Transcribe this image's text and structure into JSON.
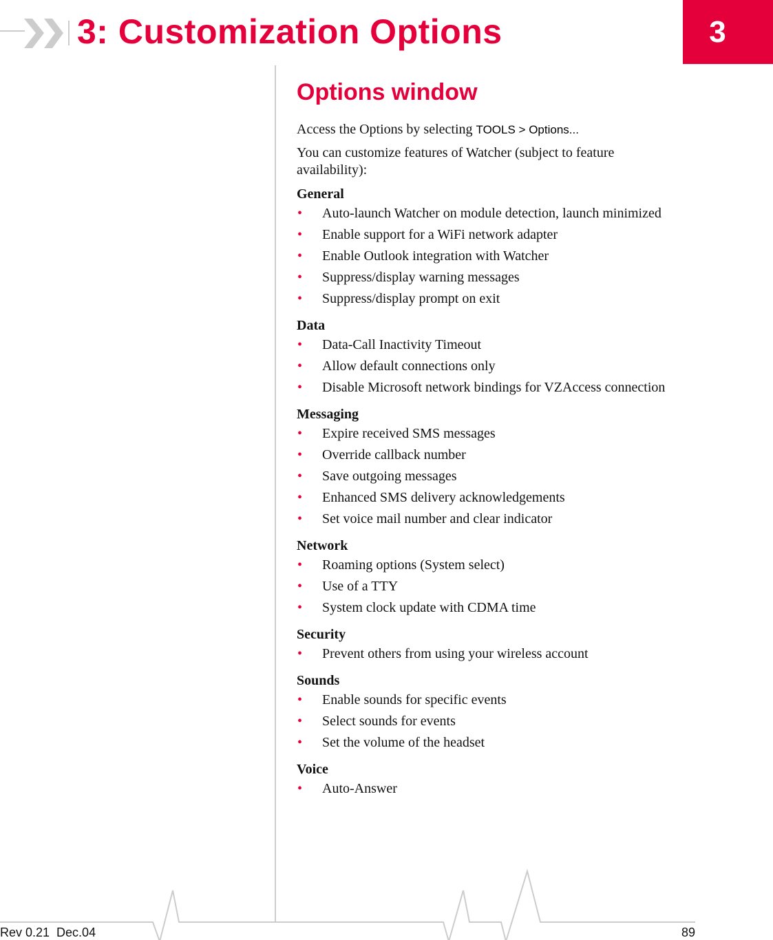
{
  "header": {
    "chapter_title": "3: Customization Options",
    "chapter_number": "3",
    "accent_color": "#e4003b",
    "decoration_icon": "double-chevron-right-icon"
  },
  "section": {
    "title": "Options window",
    "intro_prefix": "Access the Options by selecting ",
    "menu_path": "TOOLS > Options...",
    "intro_2": "You can customize features of Watcher (subject to feature availability):"
  },
  "groups": [
    {
      "label": "General",
      "items": [
        "Auto-launch Watcher on module detection, launch minimized",
        "Enable support for a WiFi network adapter",
        "Enable Outlook integration with Watcher",
        "Suppress/display warning messages",
        "Suppress/display prompt on exit"
      ]
    },
    {
      "label": "Data",
      "items": [
        "Data-Call Inactivity Timeout",
        "Allow default connections only",
        "Disable Microsoft network bindings for VZAccess connection"
      ]
    },
    {
      "label": "Messaging",
      "items": [
        "Expire received SMS messages",
        "Override callback number",
        "Save outgoing messages",
        "Enhanced SMS delivery acknowledgements",
        "Set voice mail number and clear indicator"
      ]
    },
    {
      "label": "Network",
      "items": [
        "Roaming options (System select)",
        "Use of a TTY",
        "System clock update with CDMA time"
      ]
    },
    {
      "label": "Security",
      "items": [
        "Prevent others from using your wireless account"
      ]
    },
    {
      "label": "Sounds",
      "items": [
        "Enable sounds for specific events",
        "Select sounds for events",
        "Set the volume of the headset"
      ]
    },
    {
      "label": "Voice",
      "items": [
        "Auto-Answer"
      ]
    }
  ],
  "bullet_glyph": "•",
  "footer": {
    "revision": "Rev 0.21  Dec.04",
    "page_number": "89"
  }
}
